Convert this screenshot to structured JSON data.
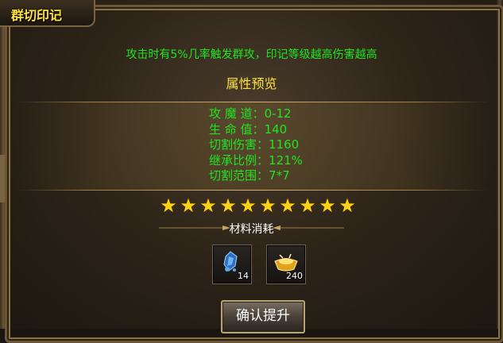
{
  "window": {
    "title": "群切印记"
  },
  "description": "攻击时有5%几率触发群攻，印记等级越高伤害越高",
  "attributes": {
    "header": "属性预览",
    "rows": [
      {
        "label": "攻 魔 道",
        "value": "0-12"
      },
      {
        "label": "生 命 值",
        "value": "140"
      },
      {
        "label": "切割伤害",
        "value": "1160"
      },
      {
        "label": "继承比例",
        "value": "121%"
      },
      {
        "label": "切割范围",
        "value": "7*7"
      }
    ]
  },
  "stars": {
    "filled": 10,
    "total": 10,
    "color": "#ffd21a"
  },
  "materials": {
    "header": "材料消耗",
    "items": [
      {
        "icon": "blue-crystal-icon",
        "count": "14"
      },
      {
        "icon": "gold-ingot-icon",
        "count": "240"
      }
    ]
  },
  "confirm_button": {
    "label": "确认提升"
  },
  "colors": {
    "title": "#ffe23a",
    "green_text": "#1fe51f",
    "gold_border": "#b9a57a"
  }
}
